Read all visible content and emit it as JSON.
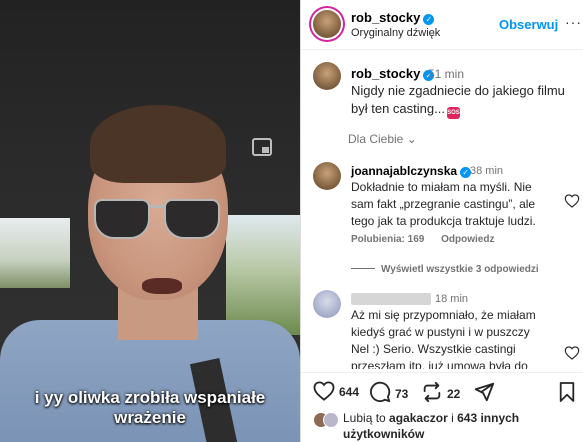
{
  "video": {
    "subtitle": "i yy oliwka zrobiła wspaniałe wrażenie",
    "pip_icon": "picture-in-picture-icon"
  },
  "header": {
    "username": "rob_stocky",
    "audio": "Oryginalny dźwięk",
    "follow_label": "Obserwuj",
    "more_label": "···"
  },
  "post": {
    "username": "rob_stocky",
    "time": "51 min",
    "caption": "Nigdy nie zgadniecie do jakiego filmu był ten casting...",
    "emoji": "SOS"
  },
  "for_you_label": "Dla Ciebie ⌄",
  "comments": [
    {
      "username": "joannajablczynska",
      "time": "38 min",
      "text": "Dokładnie to miałam na myśli. Nie sam fakt „przegranie castingu”, ale tego jak ta produkcja traktuje ludzi.",
      "likes_label": "Polubienia: 169",
      "reply_label": "Odpowiedz"
    },
    {
      "username": "",
      "time": "18 min",
      "text": "Aż mi się przypomniało, że miałam kiedyś grać w pustyni i w puszczy Nel :) Serio. Wszystkie castingi przeszłam itp. już umowa była do podpisania aż"
    }
  ],
  "view_replies_label": "Wyświetl wszystkie 3 odpowiedzi",
  "actions": {
    "likes": "644",
    "comments": "73",
    "reposts": "22"
  },
  "liked_by": {
    "prefix": "Lubią to ",
    "user": "agakaczor",
    "middle": " i ",
    "count": "643 innych użytkowników"
  },
  "colors": {
    "accent": "#0095f6",
    "verified": "#0095f6",
    "muted": "#737373"
  }
}
